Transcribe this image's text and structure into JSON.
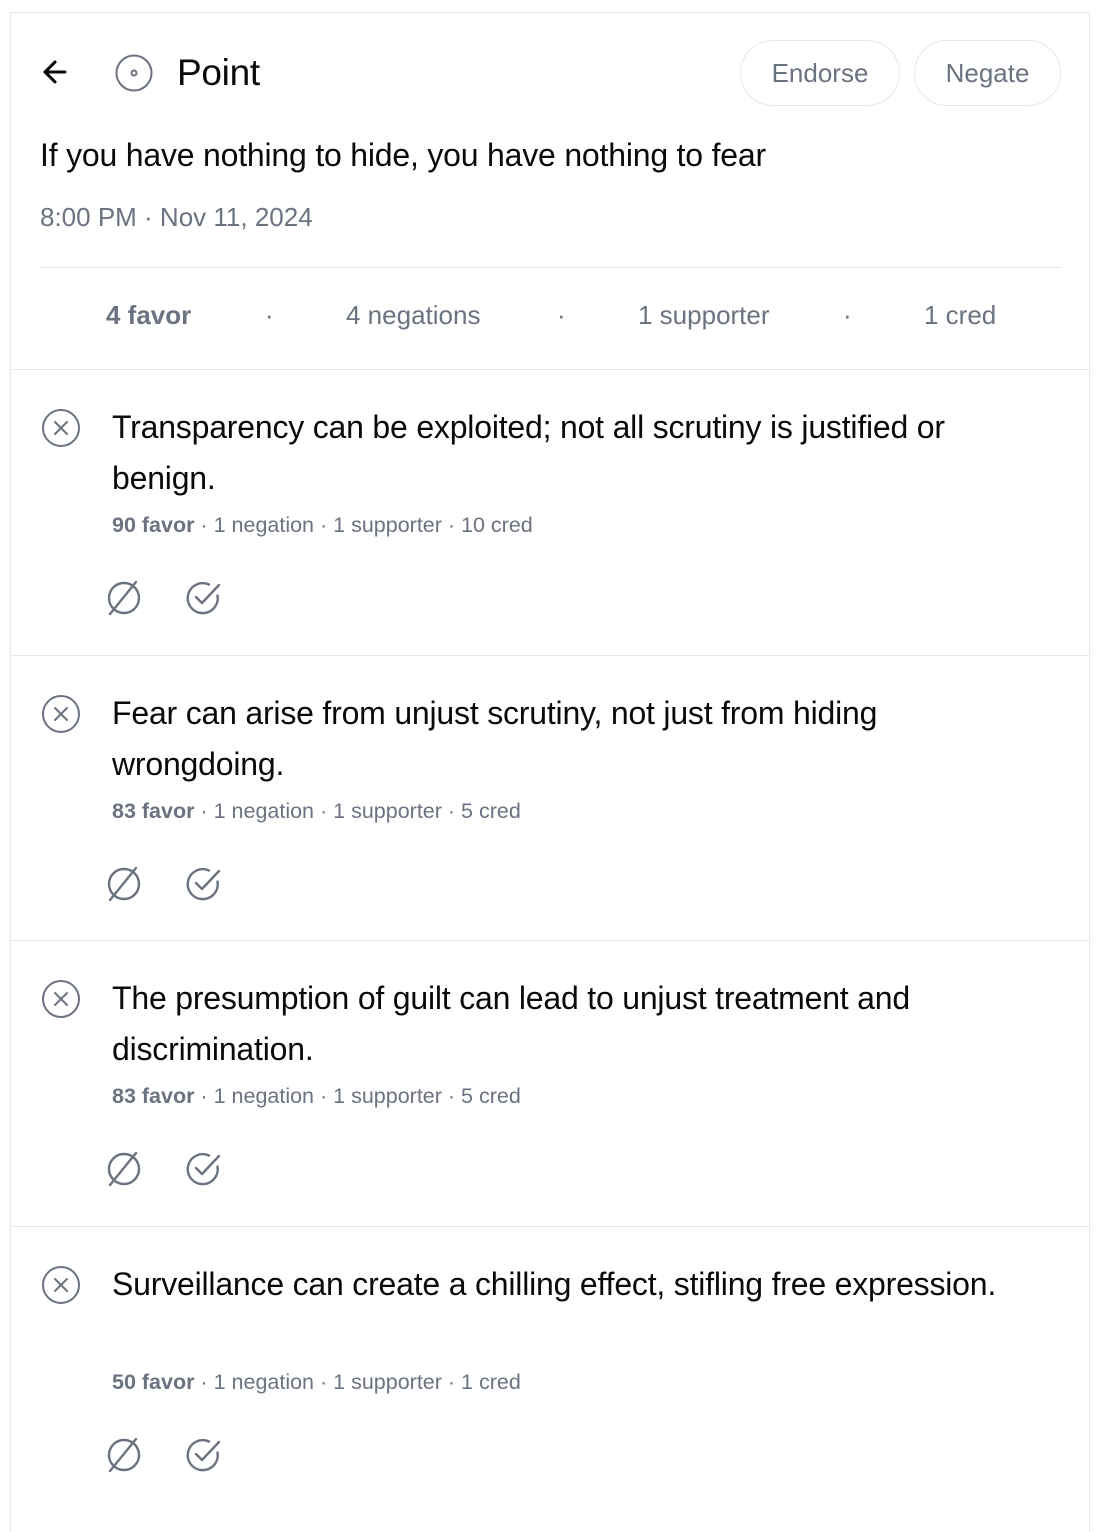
{
  "header": {
    "title": "Point",
    "endorse_label": "Endorse",
    "negate_label": "Negate"
  },
  "point": {
    "statement": "If you have nothing to hide, you have nothing to fear",
    "timestamp": "8:00 PM · Nov 11, 2024",
    "stats": {
      "favor": "4 favor",
      "negations": "4 negations",
      "supporters": "1 supporter",
      "cred": "1 cred",
      "separator": "·"
    }
  },
  "negations": [
    {
      "text": "Transparency can be exploited; not all scrutiny is justified or benign.",
      "favor": "90 favor",
      "negations": "1 negation",
      "supporters": "1 supporter",
      "cred": "10 cred"
    },
    {
      "text": "Fear can arise from unjust scrutiny, not just from hiding wrongdoing.",
      "favor": "83 favor",
      "negations": "1 negation",
      "supporters": "1 supporter",
      "cred": "5 cred"
    },
    {
      "text": "The presumption of guilt can lead to unjust treatment and discrimination.",
      "favor": "83 favor",
      "negations": "1 negation",
      "supporters": "1 supporter",
      "cred": "5 cred"
    },
    {
      "text": "Surveillance can create a chilling effect, stifling free expression.",
      "favor": "50 favor",
      "negations": "1 negation",
      "supporters": "1 supporter",
      "cred": "1 cred"
    }
  ],
  "icons": {
    "back": "arrow-left-icon",
    "point": "circle-dot-icon",
    "negation_marker": "circle-x-icon",
    "negate_action": "ban-icon",
    "endorse_action": "circle-check-icon"
  },
  "colors": {
    "text": "#0a0a0a",
    "muted": "#6b7280",
    "border": "#e5e7eb"
  }
}
